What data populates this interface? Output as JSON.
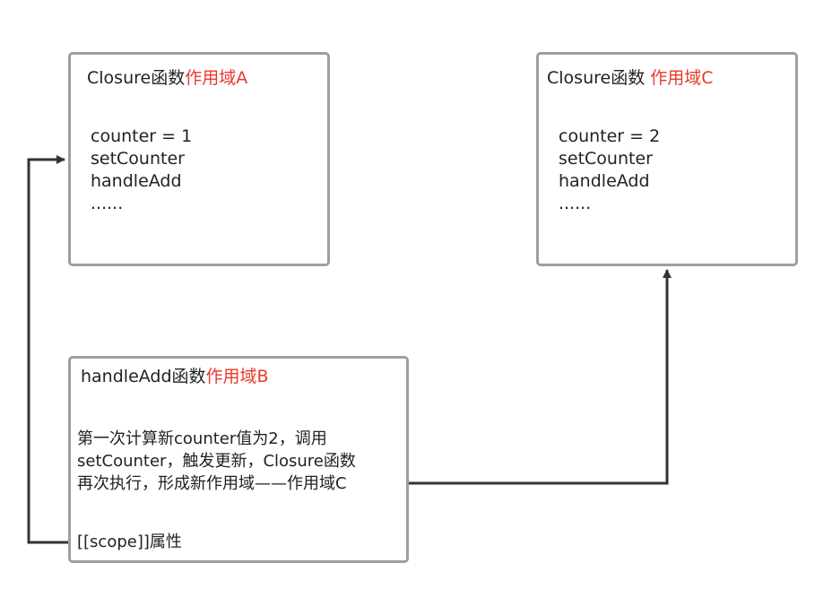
{
  "scope_a": {
    "title_prefix": "Closure函数",
    "title_highlight": "作用域A",
    "vars": [
      "counter = 1",
      "setCounter",
      "handleAdd",
      "......"
    ]
  },
  "scope_c": {
    "title_prefix": "Closure函数 ",
    "title_highlight": "作用域C",
    "vars": [
      "counter = 2",
      "setCounter",
      "handleAdd",
      "......"
    ]
  },
  "scope_b": {
    "title_prefix": "handleAdd函数",
    "title_highlight": "作用域B",
    "desc": [
      "第一次计算新counter值为2，调用",
      "setCounter，触发更新，Closure函数",
      "再次执行，形成新作用域——作用域C"
    ],
    "scope_attr": "[[scope]]属性"
  },
  "colors": {
    "highlight": "#e8392c",
    "box_border": "#9e9e9e",
    "connector": "#333333"
  }
}
